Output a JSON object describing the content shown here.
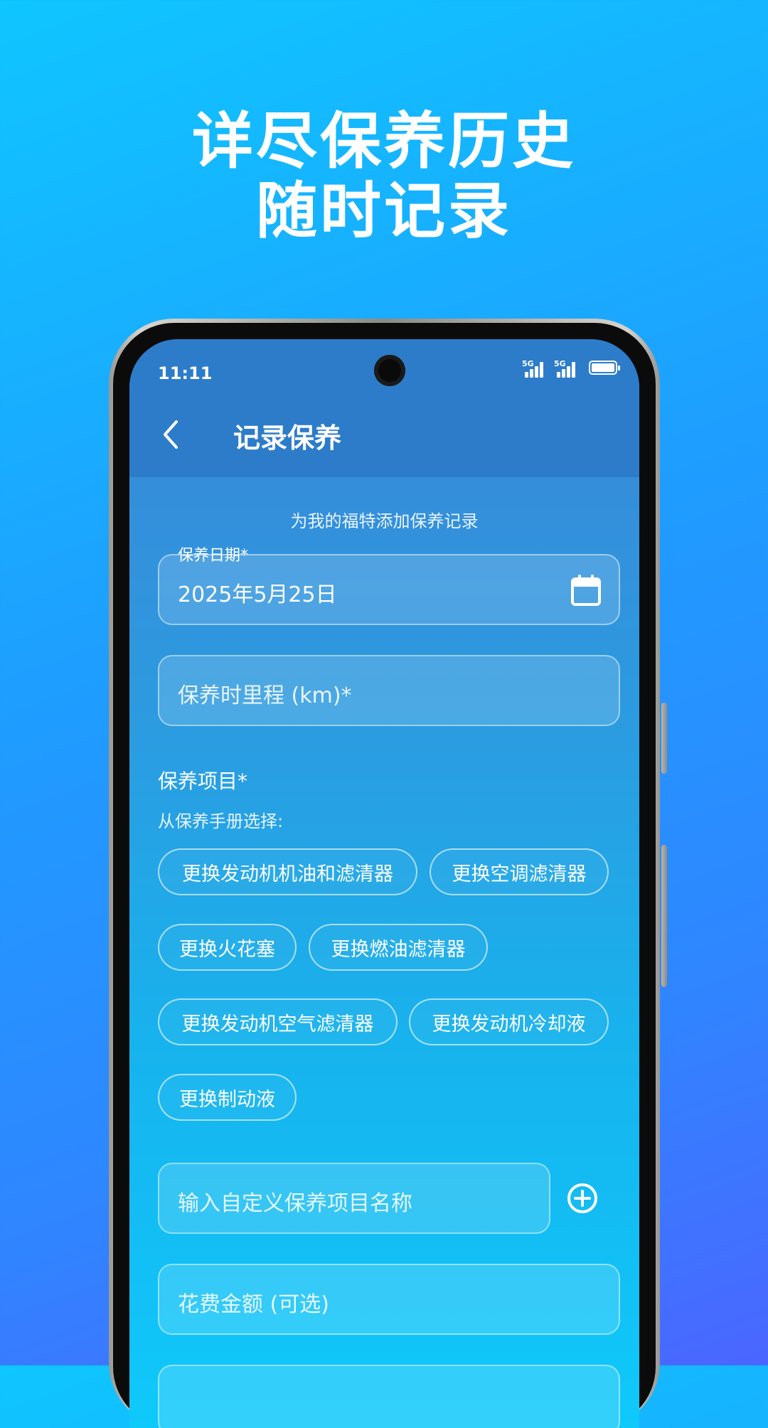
{
  "promo": {
    "headline_line1": "详尽保养历史",
    "headline_line2": "随时记录"
  },
  "status_bar": {
    "time": "11:11",
    "signal1_label": "5G",
    "signal2_label": "5G"
  },
  "app_bar": {
    "title": "记录保养"
  },
  "form": {
    "subtitle": "为我的福特添加保养记录",
    "date_label": "保养日期*",
    "date_value": "2025年5月25日",
    "mileage_placeholder": "保养时里程 (km)*",
    "items_title": "保养项目*",
    "items_hint": "从保养手册选择:",
    "chips": [
      "更换发动机机油和滤清器",
      "更换空调滤清器",
      "更换火花塞",
      "更换燃油滤清器",
      "更换发动机空气滤清器",
      "更换发动机冷却液",
      "更换制动液"
    ],
    "custom_item_placeholder": "输入自定义保养项目名称",
    "cost_placeholder": "花费金额 (可选)"
  },
  "icons": {
    "back": "chevron-left-icon",
    "calendar": "calendar-icon",
    "add": "plus-circle-icon",
    "battery": "battery-icon",
    "signal": "signal-icon"
  }
}
